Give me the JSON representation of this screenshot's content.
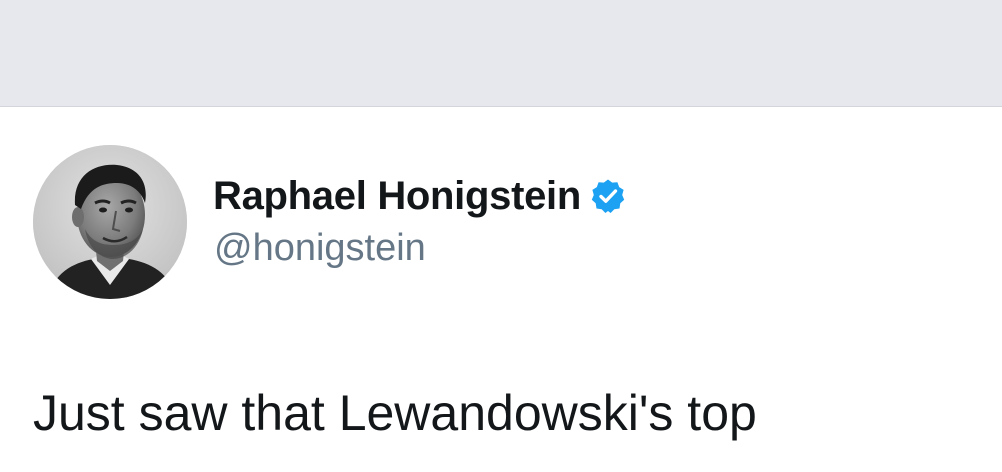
{
  "colors": {
    "header_background": "#e7e8ed",
    "name": "#14171a",
    "handle": "#657786",
    "verified_badge": "#1da1f2"
  },
  "header": {},
  "tweet": {
    "author": {
      "display_name": "Raphael Honigstein",
      "handle": "@honigstein",
      "verified": true,
      "verified_icon": "verified-badge-icon",
      "avatar_icon": "profile-photo"
    },
    "text": "Just saw that Lewandowski's top"
  }
}
